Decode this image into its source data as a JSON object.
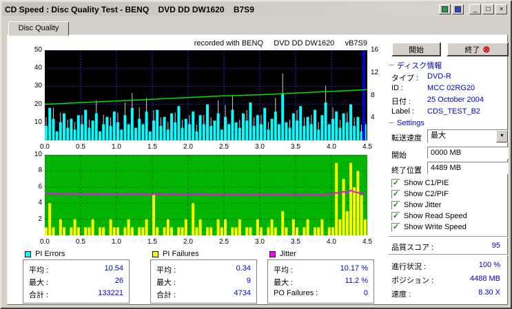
{
  "window": {
    "title": "CD Speed : Disc Quality Test - BENQ    DVD DD DW1620    B7S9",
    "controls": {
      "minimize": "_",
      "maximize": "□",
      "close": "×"
    },
    "icon_buttons": [
      {
        "name": "document-icon",
        "color": "#18a048"
      },
      {
        "name": "disc-icon",
        "color": "#2848c8"
      }
    ]
  },
  "tab": {
    "label": "Disc Quality"
  },
  "buttons": {
    "start": "開始",
    "exit": "終了",
    "exit_icon": "⊗"
  },
  "disc_info": {
    "header": "ディスク情報",
    "rows": [
      {
        "label": "タイプ :",
        "value": "DVD-R"
      },
      {
        "label": "ID :",
        "value": "MCC 02RG20"
      },
      {
        "label": "日付 :",
        "value": "25 October 2004"
      },
      {
        "label": "Label :",
        "value": "CDS_TEST_B2"
      }
    ]
  },
  "settings": {
    "header": "Settings",
    "speed_label": "転送速度",
    "speed_value": "最大",
    "arrow_glyph": "▼",
    "start_label": "開始",
    "start_value": "0000 MB",
    "end_label": "終了位置",
    "end_value": "4489 MB",
    "check_glyph": "✓",
    "checkboxes": [
      {
        "label": "Show C1/PIE",
        "checked": true
      },
      {
        "label": "Show C2/PIF",
        "checked": true
      },
      {
        "label": "Show Jitter",
        "checked": true
      },
      {
        "label": "Show Read Speed",
        "checked": true
      },
      {
        "label": "Show Write Speed",
        "checked": true
      }
    ]
  },
  "quality": {
    "label": "品質スコア :",
    "value": "95"
  },
  "progress": {
    "rows": [
      {
        "label": "進行状況 :",
        "value": "100 %"
      },
      {
        "label": "ポジション :",
        "value": "4488 MB"
      },
      {
        "label": "速度 :",
        "value": "8.30 X"
      }
    ]
  },
  "stats": [
    {
      "title": "PI Errors",
      "color": "#00ffff",
      "rows": [
        {
          "label": "平均 :",
          "value": "10.54"
        },
        {
          "label": "最大 :",
          "value": "26"
        },
        {
          "label": "合計 :",
          "value": "133221"
        }
      ]
    },
    {
      "title": "PI Failures",
      "color": "#ffff00",
      "rows": [
        {
          "label": "平均 :",
          "value": "0.34"
        },
        {
          "label": "最大 :",
          "value": "9"
        },
        {
          "label": "合計 :",
          "value": "4734"
        }
      ]
    },
    {
      "title": "Jitter",
      "color": "#ff00ff",
      "rows": [
        {
          "label": "平均 :",
          "value": "10.17 %"
        },
        {
          "label": "最大 :",
          "value": "11.2 %"
        },
        {
          "label": "PO Failures :",
          "value": "0"
        }
      ]
    }
  ],
  "chart_data": [
    {
      "type": "area",
      "name": "pi-errors-graph",
      "annotation": "recorded with BENQ     DVD DD DW1620     vB7S9",
      "x_unit": "GB",
      "x_max": 4.5,
      "x_step": 0.05,
      "x_ticks": [
        "0.0",
        "0.5",
        "1.0",
        "1.5",
        "2.0",
        "2.5",
        "3.0",
        "3.5",
        "4.0",
        "4.5"
      ],
      "y_left": {
        "min": 0,
        "max": 50,
        "ticks": [
          50,
          40,
          30,
          20,
          10
        ]
      },
      "y_right": {
        "min": 0,
        "max": 16,
        "ticks": [
          16,
          12,
          8,
          4
        ]
      },
      "end_marker_x": 4.43,
      "series": [
        {
          "name": "PI Errors",
          "color": "#00ffff",
          "values": [
            8,
            18,
            12,
            5,
            10,
            15,
            7,
            12,
            6,
            14,
            9,
            17,
            7,
            11,
            15,
            5,
            9,
            13,
            8,
            16,
            10,
            6,
            14,
            9,
            18,
            7,
            12,
            9,
            16,
            5,
            11,
            17,
            8,
            13,
            6,
            15,
            10,
            19,
            7,
            12,
            9,
            16,
            5,
            14,
            9,
            20,
            8,
            11,
            15,
            6,
            13,
            9,
            17,
            10,
            7,
            15,
            11,
            21,
            8,
            14,
            9,
            18,
            6,
            12,
            16,
            9,
            26,
            10,
            7,
            15,
            11,
            19,
            8,
            13,
            9,
            17,
            6,
            14,
            21,
            9,
            12,
            16,
            7,
            15,
            10,
            20,
            8,
            13,
            5,
            9
          ]
        },
        {
          "name": "Read Speed",
          "color": "#00e400",
          "axis": "right",
          "points": [
            [
              0,
              6.4
            ],
            [
              0.5,
              6.7
            ],
            [
              1,
              7.0
            ],
            [
              1.5,
              7.3
            ],
            [
              2,
              7.6
            ],
            [
              2.5,
              7.9
            ],
            [
              3,
              8.1
            ],
            [
              3.5,
              8.4
            ],
            [
              4,
              8.7
            ],
            [
              4.5,
              9.0
            ]
          ]
        }
      ]
    },
    {
      "type": "bar",
      "name": "pi-failures-jitter-graph",
      "x_unit": "GB",
      "x_max": 4.5,
      "x_step": 0.05,
      "x_ticks": [
        "0.0",
        "0.5",
        "1.0",
        "1.5",
        "2.0",
        "2.5",
        "3.0",
        "3.5",
        "4.0",
        "4.5"
      ],
      "y_left": {
        "min": 0,
        "max": 10,
        "ticks": [
          10,
          8,
          6,
          4,
          2
        ]
      },
      "jitter_axis": {
        "min": 0,
        "max": 20,
        "unit": "%"
      },
      "series": [
        {
          "name": "PI Failures",
          "color": "#ffff00",
          "values": [
            1,
            4,
            1,
            0,
            2,
            1,
            0,
            1,
            2,
            1,
            0,
            1,
            1,
            2,
            0,
            1,
            1,
            0,
            2,
            1,
            1,
            0,
            1,
            2,
            1,
            0,
            1,
            1,
            2,
            0,
            5,
            1,
            0,
            1,
            2,
            1,
            0,
            1,
            1,
            2,
            0,
            4,
            1,
            2,
            0,
            1,
            1,
            0,
            2,
            1,
            2,
            0,
            1,
            1,
            2,
            0,
            1,
            1,
            0,
            2,
            1,
            0,
            1,
            2,
            1,
            0,
            3,
            1,
            0,
            2,
            1,
            0,
            1,
            2,
            0,
            1,
            1,
            2,
            0,
            1,
            1,
            9,
            2,
            7,
            3,
            9,
            6,
            8,
            5,
            2
          ]
        },
        {
          "name": "Jitter %",
          "color": "#ff00ff",
          "values": [
            10.5,
            10.4,
            10.3,
            10.4,
            10.2,
            10.3,
            10.2,
            10.3,
            10.4,
            10.2,
            10.3,
            10.2,
            10.1,
            10.3,
            10.2,
            10.2,
            10.3,
            10.1,
            10.2,
            10.3,
            10.2,
            10.1,
            10.2,
            10.2,
            10.3,
            10.1,
            10.2,
            10.3,
            10.1,
            10.2,
            10.2,
            10.3,
            10.1,
            10.2,
            10.1,
            10.2,
            10.3,
            10.2,
            10.1,
            10.2,
            10.1,
            10.2,
            10.2,
            10.3,
            10.1,
            10.2,
            10.1,
            10.0,
            10.2,
            10.1,
            10.2,
            10.1,
            10.0,
            10.1,
            10.2,
            10.1,
            10.0,
            10.1,
            10.1,
            10.2,
            10.0,
            10.1,
            10.2,
            10.1,
            10.0,
            10.1,
            10.2,
            10.1,
            10.0,
            10.1,
            10.1,
            10.0,
            10.1,
            10.2,
            10.1,
            10.0,
            10.1,
            10.0,
            10.1,
            10.2,
            10.3,
            10.6,
            10.4,
            10.9,
            10.5,
            11.2,
            10.8,
            10.6,
            10.4,
            10.2
          ]
        }
      ]
    }
  ]
}
